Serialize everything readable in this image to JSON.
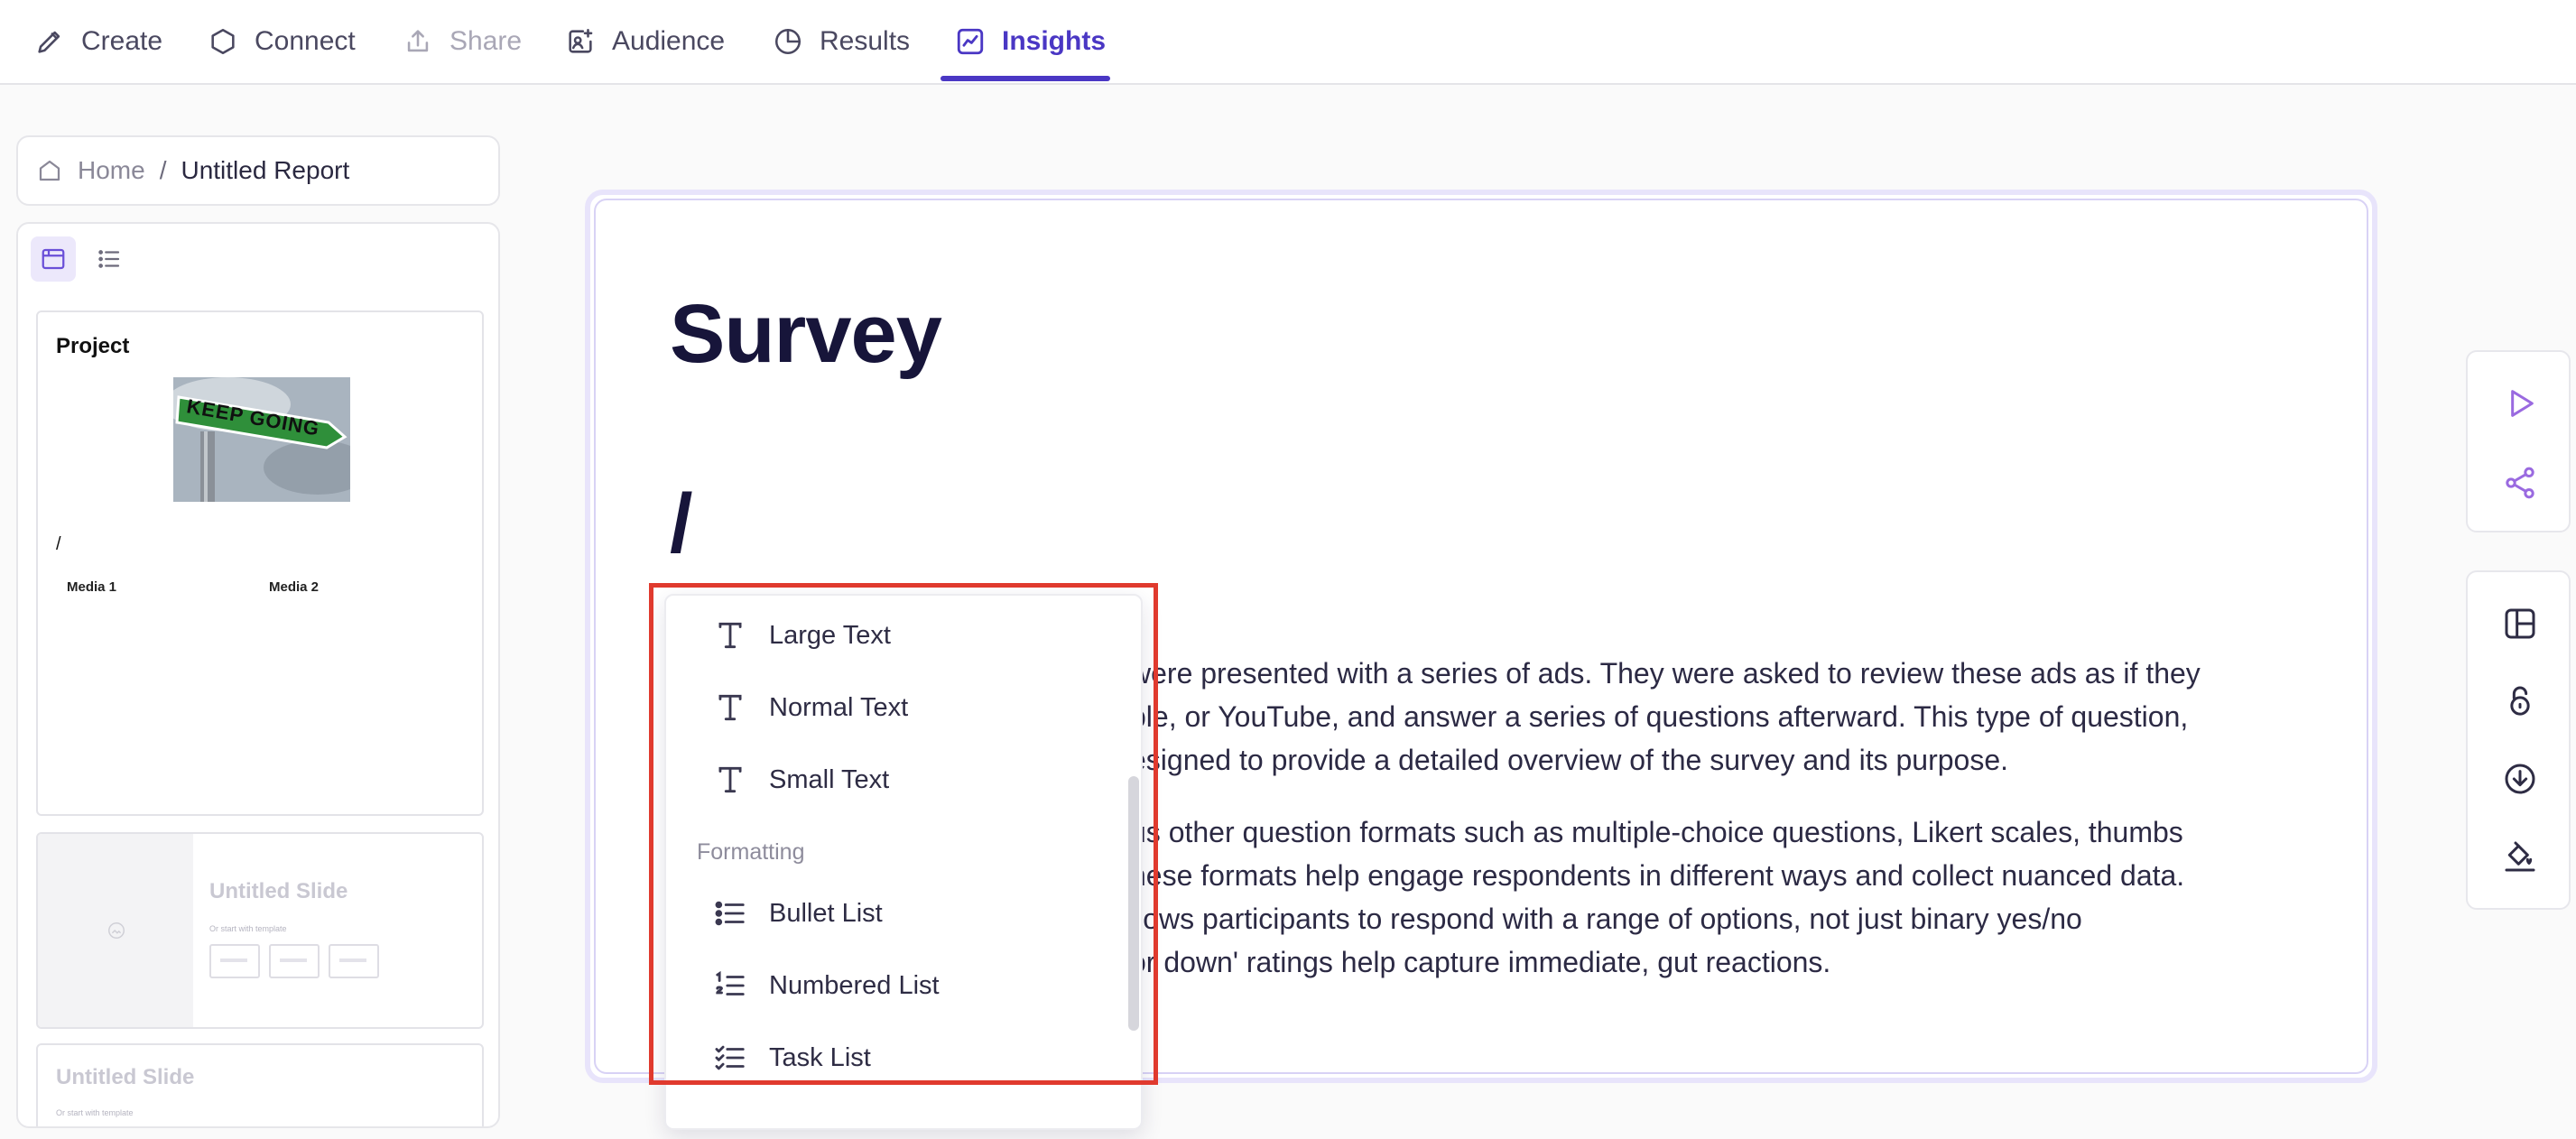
{
  "nav": {
    "tabs": [
      {
        "label": "Create",
        "icon": "pencil-icon",
        "state": "normal"
      },
      {
        "label": "Connect",
        "icon": "hexagon-icon",
        "state": "normal"
      },
      {
        "label": "Share",
        "icon": "share-upload-icon",
        "state": "disabled"
      },
      {
        "label": "Audience",
        "icon": "audience-icon",
        "state": "normal"
      },
      {
        "label": "Results",
        "icon": "pie-chart-icon",
        "state": "normal"
      },
      {
        "label": "Insights",
        "icon": "trend-chart-icon",
        "state": "active"
      }
    ],
    "accent_color": "#4a37c4"
  },
  "breadcrumb": {
    "home": "Home",
    "separator": "/",
    "current": "Untitled Report"
  },
  "slides": {
    "card1": {
      "title": "Project",
      "image_text": "KEEP GOING",
      "slash": "/",
      "media1": "Media 1",
      "media2": "Media 2"
    },
    "card2": {
      "title": "Untitled Slide",
      "subtitle": "Or start with template"
    },
    "card3": {
      "title": "Untitled Slide",
      "subtitle": "Or start with template"
    }
  },
  "document": {
    "title": "Survey",
    "slash": "/",
    "para1_lines": [
      "were presented with a series of ads. They were asked to review these ads as if they",
      "ple, or YouTube, and answer a series of questions afterward. This type of question,",
      "esigned to provide a detailed overview of the survey and its purpose."
    ],
    "para2_lines": [
      "us other question formats such as multiple-choice questions, Likert scales, thumbs",
      "hese formats help engage respondents in different ways and collect nuanced data.",
      "llows participants to respond with a range of options, not just binary yes/no",
      "or down' ratings help capture immediate, gut reactions."
    ]
  },
  "command_menu": {
    "text_items": [
      "Large Text",
      "Normal Text",
      "Small Text"
    ],
    "formatting_label": "Formatting",
    "formatting_items": [
      "Bullet List",
      "Numbered List",
      "Task List"
    ],
    "highlight_color": "#e03a2e"
  },
  "toolbar": {
    "icons": [
      "play-icon",
      "share-nodes-icon",
      "layout-icon",
      "lock-icon",
      "download-icon",
      "paint-bucket-icon"
    ],
    "icon_color": "#9a6ae0"
  }
}
